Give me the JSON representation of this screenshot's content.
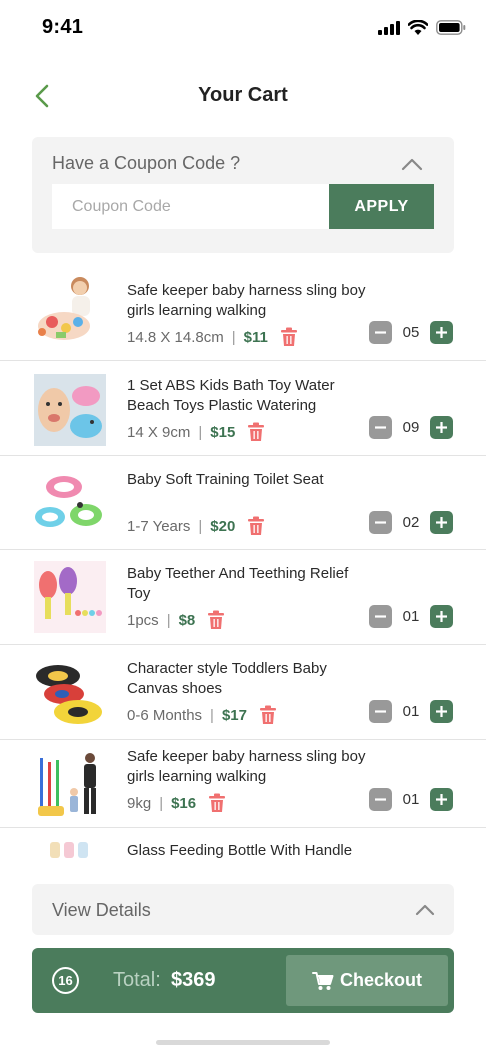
{
  "status_bar": {
    "time": "9:41"
  },
  "header": {
    "title": "Your Cart"
  },
  "coupon": {
    "heading": "Have a Coupon Code ?",
    "placeholder": "Coupon Code",
    "value": "",
    "apply_label": "APPLY"
  },
  "items": [
    {
      "name": "Safe keeper baby harness sling boy girls learning walking",
      "spec": "14.8 X 14.8cm",
      "price": "$11",
      "qty": "05"
    },
    {
      "name": "1 Set ABS Kids Bath Toy Water Beach Toys Plastic Watering",
      "spec": "14 X 9cm",
      "price": "$15",
      "qty": "09"
    },
    {
      "name": "Baby Soft Training Toilet Seat",
      "spec": "1-7 Years",
      "price": "$20",
      "qty": "02"
    },
    {
      "name": "Baby Teether And Teething Relief Toy",
      "spec": "1pcs",
      "price": "$8",
      "qty": "01"
    },
    {
      "name": "Character style Toddlers Baby Canvas shoes",
      "spec": "0-6 Months",
      "price": "$17",
      "qty": "01"
    },
    {
      "name": "Safe keeper baby harness sling boy girls learning walking",
      "spec": "9kg",
      "price": "$16",
      "qty": "01"
    },
    {
      "name": "Glass Feeding Bottle With Handle",
      "spec": "",
      "price": "",
      "qty": ""
    }
  ],
  "details": {
    "label": "View Details"
  },
  "checkout": {
    "item_count": "16",
    "total_label": "Total:",
    "total_value": "$369",
    "button_label": "Checkout"
  },
  "colors": {
    "accent": "#4b7c5c",
    "price": "#3d7351",
    "trash": "#f07070",
    "qty_minus": "#999999",
    "panel_bg": "#f3f3f3"
  },
  "icons": [
    "signal-icon",
    "wifi-icon",
    "battery-icon",
    "back-chevron-icon",
    "chevron-up-icon",
    "trash-icon",
    "minus-icon",
    "plus-icon",
    "cart-icon"
  ]
}
